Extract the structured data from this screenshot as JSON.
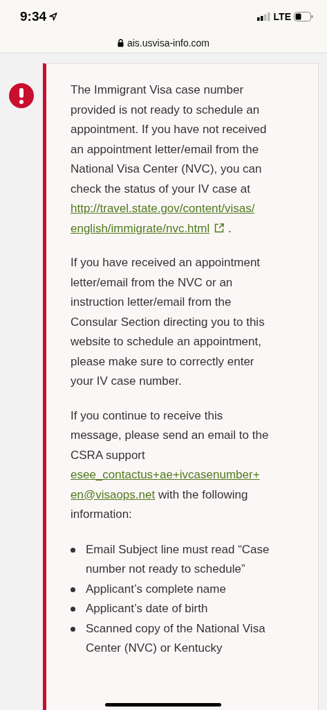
{
  "status_bar": {
    "time": "9:34",
    "network": "LTE"
  },
  "address_bar": {
    "url": "ais.usvisa-info.com"
  },
  "alert": {
    "paragraphs": [
      {
        "text": "The Immigrant Visa case number provided is not ready to schedule an appointment. If you have not received an appointment letter/email from the National Visa Center (NVC), you can check the status of your IV case at",
        "link_lines": [
          "http://travel.state.gov/content/visas/",
          "english/immigrate/nvc.html"
        ],
        "external": true,
        "after": "."
      },
      {
        "text": "If you have received an appointment letter/email from the NVC or an instruction letter/email from the Consular Section directing you to this website to schedule an appointment, please make sure to correctly enter your IV case number."
      },
      {
        "text": "If you continue to receive this message, please send an email to the CSRA support",
        "link_lines": [
          "esee_contactus+ae+ivcasenumber+",
          "en@visaops.net"
        ],
        "after": "with the following information:"
      }
    ],
    "bullets": [
      "Email Subject line must read “Case number not ready to schedule”",
      "Applicant’s complete name",
      "Applicant’s date of birth",
      "Scanned copy of the National Visa Center (NVC) or Kentucky"
    ]
  }
}
